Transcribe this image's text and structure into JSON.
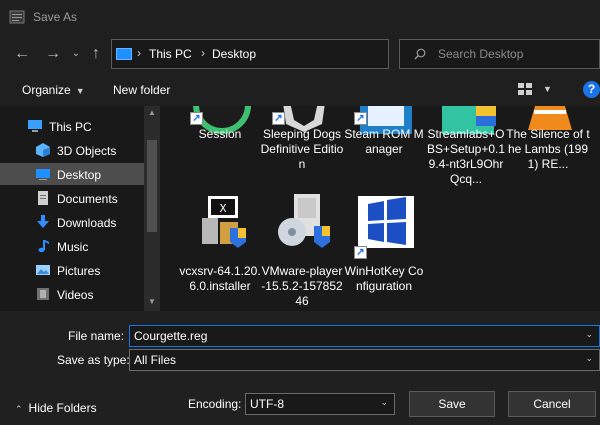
{
  "window": {
    "title": "Save As"
  },
  "nav": {
    "back": "←",
    "forward": "→",
    "dropdown": "⌄",
    "up": "↑",
    "address": {
      "crumbs": [
        "This PC",
        "Desktop"
      ],
      "separator": "›",
      "dropdown": "⌄"
    },
    "refresh": "↻",
    "search_placeholder": "Search Desktop"
  },
  "toolbar": {
    "organize": "Organize",
    "new_folder": "New folder",
    "caret": "▼"
  },
  "sidebar": {
    "items": [
      {
        "label": "This PC",
        "icon": "computer-icon",
        "color": "#3aa0ff"
      },
      {
        "label": "3D Objects",
        "icon": "cube-icon",
        "color": "#5ab4ff"
      },
      {
        "label": "Desktop",
        "icon": "desktop-icon",
        "color": "#1e90ff",
        "selected": true
      },
      {
        "label": "Documents",
        "icon": "documents-icon",
        "color": "#b0b0b0"
      },
      {
        "label": "Downloads",
        "icon": "download-icon",
        "color": "#2f8fff"
      },
      {
        "label": "Music",
        "icon": "music-icon",
        "color": "#2f8fff"
      },
      {
        "label": "Pictures",
        "icon": "pictures-icon",
        "color": "#9ad0ff"
      },
      {
        "label": "Videos",
        "icon": "videos-icon",
        "color": "#9a9a9a"
      }
    ]
  },
  "files": [
    {
      "name": "Session",
      "shortcut": true
    },
    {
      "name": "Sleeping Dogs Definitive Edition",
      "shortcut": true
    },
    {
      "name": "Steam ROM Manager",
      "shortcut": true
    },
    {
      "name": "Streamlabs+OBS+Setup+0.19.4-nt3rL9OhrQcq...",
      "shortcut": false
    },
    {
      "name": "The Silence of the Lambs (1991) RE...",
      "shortcut": false
    },
    {
      "name": "vcxsrv-64.1.20.6.0.installer",
      "shortcut": false
    },
    {
      "name": "VMware-player-15.5.2-15785246",
      "shortcut": false
    },
    {
      "name": "WinHotKey Configuration",
      "shortcut": true
    }
  ],
  "form": {
    "file_name_label": "File name:",
    "file_name_value": "Courgette.reg",
    "save_type_label": "Save as type:",
    "save_type_value": "All Files",
    "encoding_label": "Encoding:",
    "encoding_value": "UTF-8",
    "dropdown_arrow": "⌄"
  },
  "footer": {
    "hide_folders": "Hide Folders",
    "chev": "⌃",
    "save": "Save",
    "cancel": "Cancel"
  },
  "colors": {
    "accent": "#1a73e8",
    "background": "#191919",
    "selected": "#4d4d4d"
  }
}
